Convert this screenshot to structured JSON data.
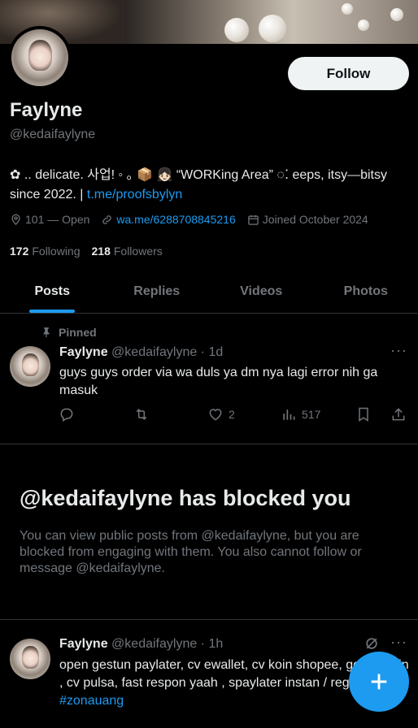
{
  "profile": {
    "name": "Faylyne",
    "handle": "@kedaifaylyne",
    "follow_label": "Follow",
    "bio_text": "✿ .. delicate. 사업! ◦ ｡ 📦 👧🏻 “WORKing Area” ◌⁚ eeps, itsy—bitsy since 2022. | ",
    "bio_link": "t.me/proofsbylyn",
    "location": "101 — Open",
    "website": "wa.me/6288708845216",
    "joined": "Joined October 2024",
    "following_count": "172",
    "following_label": "Following",
    "followers_count": "218",
    "followers_label": "Followers"
  },
  "tabs": [
    {
      "label": "Posts"
    },
    {
      "label": "Replies"
    },
    {
      "label": "Videos"
    },
    {
      "label": "Photos"
    }
  ],
  "pinned_label": "Pinned",
  "posts": [
    {
      "name": "Faylyne",
      "handle_time": "@kedaifaylyne · 1d",
      "text": "guys guys order via wa duls ya dm nya lagi error nih ga masuk",
      "likes": "2",
      "views": "517"
    },
    {
      "name": "Faylyne",
      "handle_time": "@kedaifaylyne · 1h",
      "text": "open gestun paylater, cv ewallet, cv koin shopee, gopay coin , cv pulsa, fast respon yaah , spaylater instan / reg yaa ",
      "hashtag": "#zonauang"
    }
  ],
  "blocked": {
    "title": "@kedaifaylyne has blocked you",
    "text": "You can view public posts from @kedaifaylyne, but you are blocked from engaging with them. You also cannot follow or message @kedaifaylyne."
  },
  "colors": {
    "accent": "#1d9bf0",
    "background": "#000000",
    "secondary_text": "#71767b"
  }
}
